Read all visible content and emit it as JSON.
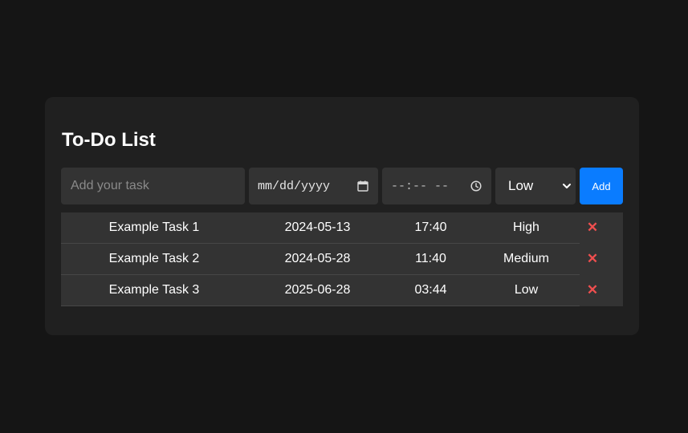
{
  "title": "To-Do List",
  "form": {
    "task_placeholder": "Add your task",
    "date_placeholder": "mm/dd/yyyy",
    "time_placeholder": "--:-- --",
    "priority_selected": "Low",
    "add_label": "Add"
  },
  "tasks": [
    {
      "name": "Example Task 1",
      "date": "2024-05-13",
      "time": "17:40",
      "priority": "High",
      "delete": "✕"
    },
    {
      "name": "Example Task 2",
      "date": "2024-05-28",
      "time": "11:40",
      "priority": "Medium",
      "delete": "✕"
    },
    {
      "name": "Example Task 3",
      "date": "2025-06-28",
      "time": "03:44",
      "priority": "Low",
      "delete": "✕"
    }
  ],
  "colors": {
    "background": "#151515",
    "card": "#202020",
    "field": "#333333",
    "accent": "#0a7cff",
    "delete": "#ef4f4f"
  },
  "icons": [
    "calendar-icon",
    "clock-icon",
    "chevron-down-icon",
    "close-icon"
  ]
}
